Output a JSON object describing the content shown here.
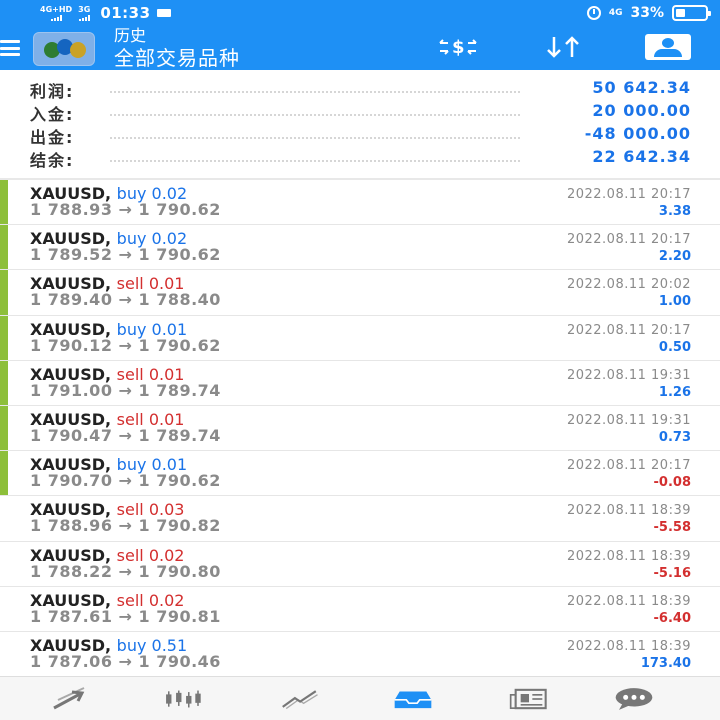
{
  "status_bar": {
    "network_left": "4G+HD",
    "network_left_2": "3G",
    "time": "01:33",
    "network_right": "4G",
    "battery": "33%"
  },
  "app_bar": {
    "title_small": "历史",
    "title_large": "全部交易品种",
    "currency_icon": "currency-exchange-icon",
    "sort_icon": "sort-icon",
    "account_icon": "account-card-icon"
  },
  "summary": [
    {
      "label": "利润:",
      "value": "50 642.34"
    },
    {
      "label": "入金:",
      "value": "20 000.00"
    },
    {
      "label": "出金:",
      "value": "-48 000.00"
    },
    {
      "label": "结余:",
      "value": "22 642.34"
    }
  ],
  "trades": [
    {
      "symbol": "XAUUSD,",
      "type": "buy 0.02",
      "side": "buy",
      "prices": "1 788.93 → 1 790.62",
      "date": "2022.08.11 20:17",
      "profit": "3.38",
      "sign": "pos",
      "marked": true
    },
    {
      "symbol": "XAUUSD,",
      "type": "buy 0.02",
      "side": "buy",
      "prices": "1 789.52 → 1 790.62",
      "date": "2022.08.11 20:17",
      "profit": "2.20",
      "sign": "pos",
      "marked": true
    },
    {
      "symbol": "XAUUSD,",
      "type": "sell 0.01",
      "side": "sell",
      "prices": "1 789.40 → 1 788.40",
      "date": "2022.08.11 20:02",
      "profit": "1.00",
      "sign": "pos",
      "marked": true
    },
    {
      "symbol": "XAUUSD,",
      "type": "buy 0.01",
      "side": "buy",
      "prices": "1 790.12 → 1 790.62",
      "date": "2022.08.11 20:17",
      "profit": "0.50",
      "sign": "pos",
      "marked": true
    },
    {
      "symbol": "XAUUSD,",
      "type": "sell 0.01",
      "side": "sell",
      "prices": "1 791.00 → 1 789.74",
      "date": "2022.08.11 19:31",
      "profit": "1.26",
      "sign": "pos",
      "marked": true
    },
    {
      "symbol": "XAUUSD,",
      "type": "sell 0.01",
      "side": "sell",
      "prices": "1 790.47 → 1 789.74",
      "date": "2022.08.11 19:31",
      "profit": "0.73",
      "sign": "pos",
      "marked": true
    },
    {
      "symbol": "XAUUSD,",
      "type": "buy 0.01",
      "side": "buy",
      "prices": "1 790.70 → 1 790.62",
      "date": "2022.08.11 20:17",
      "profit": "-0.08",
      "sign": "neg",
      "marked": true
    },
    {
      "symbol": "XAUUSD,",
      "type": "sell 0.03",
      "side": "sell",
      "prices": "1 788.96 → 1 790.82",
      "date": "2022.08.11 18:39",
      "profit": "-5.58",
      "sign": "neg",
      "marked": false
    },
    {
      "symbol": "XAUUSD,",
      "type": "sell 0.02",
      "side": "sell",
      "prices": "1 788.22 → 1 790.80",
      "date": "2022.08.11 18:39",
      "profit": "-5.16",
      "sign": "neg",
      "marked": false
    },
    {
      "symbol": "XAUUSD,",
      "type": "sell 0.02",
      "side": "sell",
      "prices": "1 787.61 → 1 790.81",
      "date": "2022.08.11 18:39",
      "profit": "-6.40",
      "sign": "neg",
      "marked": false
    },
    {
      "symbol": "XAUUSD,",
      "type": "buy 0.51",
      "side": "buy",
      "prices": "1 787.06 → 1 790.46",
      "date": "2022.08.11 18:39",
      "profit": "173.40",
      "sign": "pos",
      "marked": false
    }
  ],
  "bottom_nav": [
    {
      "name": "nav-quotes",
      "icon": "quotes-arrows-icon",
      "active": false
    },
    {
      "name": "nav-chart",
      "icon": "candlestick-icon",
      "active": false
    },
    {
      "name": "nav-trade",
      "icon": "trade-trend-icon",
      "active": false
    },
    {
      "name": "nav-history",
      "icon": "history-inbox-icon",
      "active": true
    },
    {
      "name": "nav-news",
      "icon": "news-icon",
      "active": false
    },
    {
      "name": "nav-messages",
      "icon": "chat-bubble-icon",
      "active": false
    }
  ],
  "colors": {
    "header_blue": "#1e90f5",
    "buy_blue": "#1a73e8",
    "sell_red": "#d32f2f",
    "marker_green": "#8dbf3a",
    "muted_gray": "#8a8a8a"
  }
}
